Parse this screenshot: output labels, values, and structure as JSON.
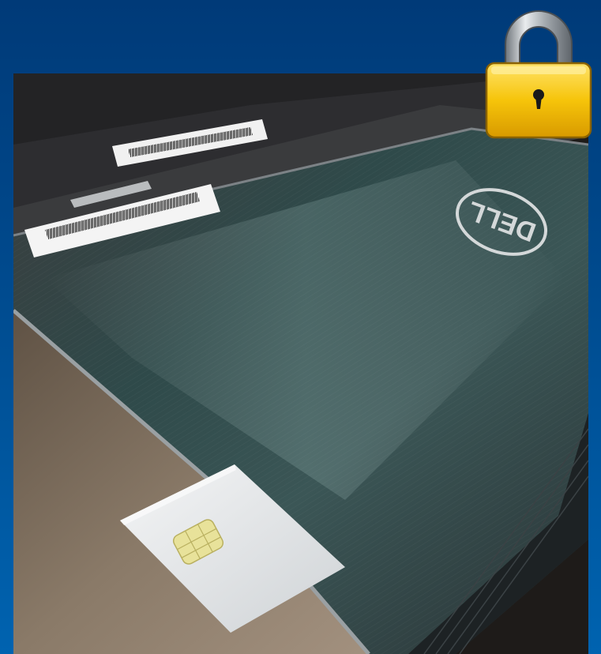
{
  "slide": {
    "background_top": "#003a78",
    "background_bottom": "#0063b0"
  },
  "photo": {
    "laptop_brand_logo": "DELL",
    "lid_color": "#2b3a3a",
    "card_color": "#e6e8ea",
    "chip_color": "#e8e29a"
  },
  "lock_icon": {
    "icon": "padlock-icon",
    "body_color": "#f6c40a",
    "shackle_color": "#9ea4aa"
  }
}
